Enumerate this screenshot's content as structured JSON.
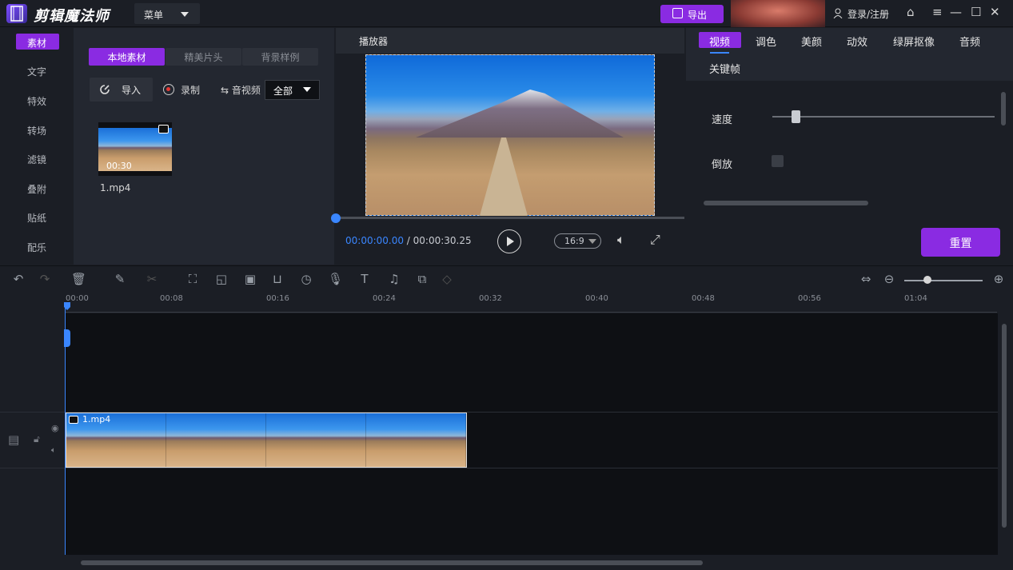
{
  "app": {
    "title": "剪辑魔法师",
    "menu_label": "菜单",
    "export_label": "导出",
    "login_label": "登录/注册"
  },
  "categories": [
    "素材",
    "文字",
    "特效",
    "转场",
    "滤镜",
    "叠附",
    "贴纸",
    "配乐"
  ],
  "media": {
    "tabs": [
      "本地素材",
      "精美片头",
      "背景样例"
    ],
    "import_label": "导入",
    "record_label": "录制",
    "av_label": "音视频",
    "filter_value": "全部",
    "items": [
      {
        "name": "1.mp4",
        "duration": "00:30"
      }
    ]
  },
  "player": {
    "title": "播放器",
    "current_time": "00:00:00.00",
    "total_time": " / 00:00:30.25",
    "ratio": "16:9"
  },
  "props": {
    "tabs": [
      "视频",
      "调色",
      "美颜",
      "动效",
      "绿屏抠像",
      "音频"
    ],
    "tab_row2": "关键帧",
    "speed_label": "速度",
    "reverse_label": "倒放",
    "reset_label": "重置"
  },
  "timeline": {
    "ticks": [
      "00:00",
      "00:08",
      "00:16",
      "00:24",
      "00:32",
      "00:40",
      "00:48",
      "00:56",
      "01:04"
    ],
    "clip_name": "1.mp4"
  },
  "colors": {
    "accent": "#8a2be2",
    "playhead": "#3a86ff"
  }
}
